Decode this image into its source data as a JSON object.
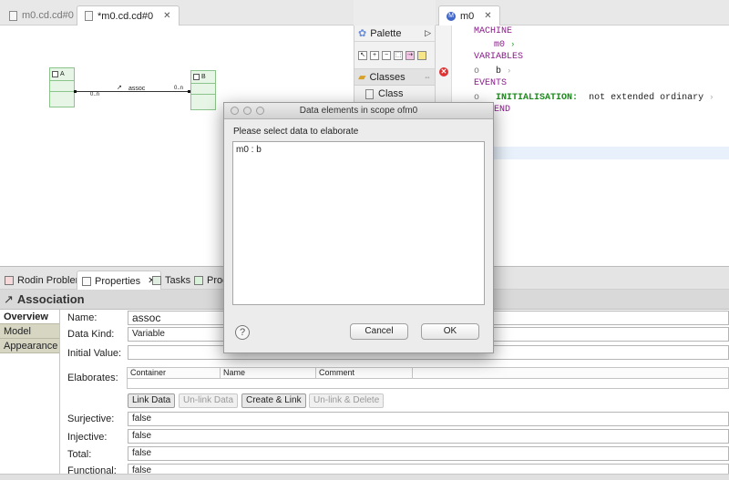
{
  "left_editor": {
    "tabs": [
      {
        "label": "m0.cd.cd#0",
        "active": false
      },
      {
        "label": "*m0.cd.cd#0",
        "active": true
      }
    ],
    "diagram": {
      "class_a": "A",
      "class_b": "B",
      "association": "assoc",
      "multiplicity_source": "0..n",
      "multiplicity_target": "0..n"
    }
  },
  "palette": {
    "title": "Palette",
    "drawer": "Classes",
    "entry": "Class"
  },
  "right_editor": {
    "tab": "m0",
    "lines": {
      "machine_kw": "MACHINE",
      "machine_name": "m0",
      "variables_kw": "VARIABLES",
      "variable_b": "b",
      "events_kw": "EVENTS",
      "init_kw": "INITIALISATION:",
      "init_text": "not extended ordinary",
      "end_kw": "END"
    }
  },
  "views": {
    "tabs": [
      "Rodin Problems",
      "Properties",
      "Tasks",
      "Prog"
    ]
  },
  "properties": {
    "title": "Association",
    "side_tabs": [
      "Overview",
      "Model",
      "Appearance"
    ],
    "fields": {
      "name_label": "Name:",
      "name_value": "assoc",
      "datakind_label": "Data Kind:",
      "datakind_value": "Variable",
      "initial_label": "Initial Value:",
      "initial_value": "",
      "elaborates_label": "Elaborates:",
      "surjective_label": "Surjective:",
      "surjective_value": "false",
      "injective_label": "Injective:",
      "injective_value": "false",
      "total_label": "Total:",
      "total_value": "false",
      "functional_label": "Functional:",
      "functional_value": "false"
    },
    "table_headers": [
      "Container",
      "Name",
      "Comment"
    ],
    "buttons": {
      "link": "Link Data",
      "unlink": "Un-link Data",
      "create_link": "Create & Link",
      "unlink_delete": "Un-link & Delete"
    }
  },
  "dialog": {
    "title": "Data elements in scope ofm0",
    "prompt": "Please select data to elaborate",
    "items": [
      "m0 : b"
    ],
    "cancel": "Cancel",
    "ok": "OK",
    "help": "?"
  }
}
